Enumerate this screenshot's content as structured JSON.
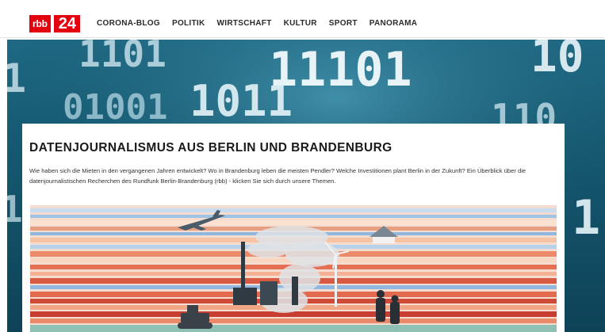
{
  "brand": {
    "logo_prefix": "rbb",
    "logo_number": "24",
    "accent_color": "#e3000f"
  },
  "nav": {
    "items": [
      {
        "label": "CORONA-BLOG"
      },
      {
        "label": "POLITIK"
      },
      {
        "label": "WIRTSCHAFT"
      },
      {
        "label": "KULTUR"
      },
      {
        "label": "SPORT"
      },
      {
        "label": "PANORAMA"
      }
    ]
  },
  "hero": {
    "background": "binary-digits-image",
    "digits": [
      "1101",
      "10",
      "11101",
      "1",
      "01001",
      "1011",
      "110",
      "1",
      "1"
    ]
  },
  "intro": {
    "title": "DATENJOURNALISMUS AUS BERLIN UND BRANDENBURG",
    "text": "Wie haben sich die Mieten in den vergangenen Jahren entwickelt? Wo in Brandenburg leben die meisten Pendler? Welche Investitionen plant Berlin in der Zukunft? Ein Überblick über die datenjournalistischen Recherchen des Rundfunk Berlin-Brandenburg (rbb) - klicken Sie sich durch unsere Themen.",
    "illustration": "climate-stripes-illustration"
  }
}
